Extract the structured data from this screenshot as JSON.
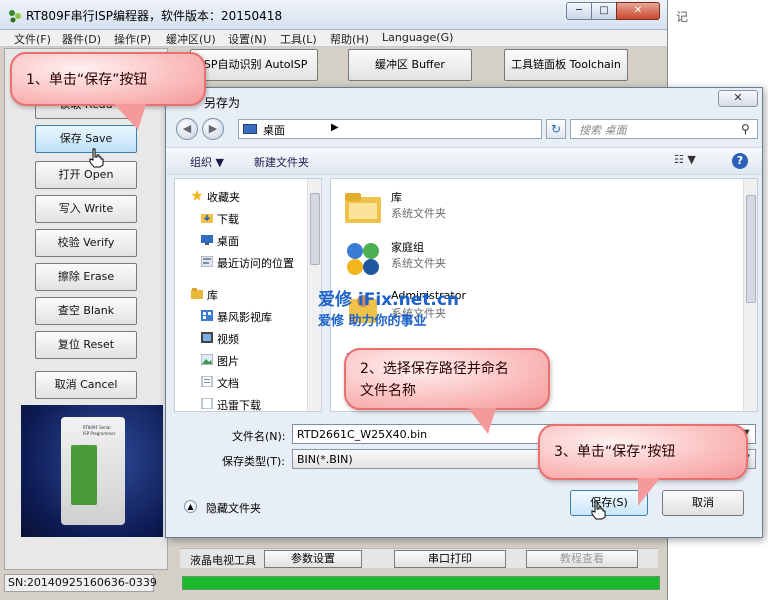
{
  "app": {
    "title": "RT809F串行ISP编程器，软件版本：20150418",
    "min_glyph": "─",
    "max_glyph": "□",
    "close_glyph": "✕"
  },
  "menu": [
    "文件(F)",
    "器件(D)",
    "操作(P)",
    "缓冲区(U)",
    "设置(N)",
    "工具(L)",
    "帮助(H)",
    "Language(G)"
  ],
  "top_buttons": {
    "autoisp": "ISP自动识别 AutoISP",
    "buffer": "缓冲区 Buffer",
    "toolchain": "工具链面板 Toolchain"
  },
  "side_buttons": [
    {
      "label": "读取 Read"
    },
    {
      "label": "保存 Save"
    },
    {
      "label": "打开 Open"
    },
    {
      "label": "写入 Write"
    },
    {
      "label": "校验 Verify"
    },
    {
      "label": "擦除 Erase"
    },
    {
      "label": "查空 Blank"
    },
    {
      "label": "复位 Reset"
    },
    {
      "label": "取消 Cancel"
    }
  ],
  "device": {
    "label1": "RT809F Serial",
    "label2": "ISP Programmer"
  },
  "status": {
    "sn": "SN:20140925160636-0339"
  },
  "bottom": {
    "lcd_label": "液晶电视工具",
    "params": "参数设置",
    "serial": "串口打印",
    "tutorial": "教程查看"
  },
  "background_right": "记",
  "dialog": {
    "title": "另存为",
    "close_glyph": "✕",
    "address": "桌面",
    "address_arrow": "▶",
    "dropdown_glyph": "▼",
    "refresh_glyph": "↻",
    "search_placeholder": "搜索 桌面",
    "search_glyph": "⚲",
    "organize": "组织 ▼",
    "new_folder": "新建文件夹",
    "view_glyph": "☷ ▼",
    "help_glyph": "?",
    "nav": {
      "favorites_header": "收藏夹",
      "favorites": [
        "下载",
        "桌面",
        "最近访问的位置"
      ],
      "libraries_header": "库",
      "libraries": [
        "暴风影视库",
        "视频",
        "图片",
        "文档",
        "迅雷下载"
      ]
    },
    "files": [
      {
        "name": "库",
        "type": "系统文件夹"
      },
      {
        "name": "家庭组",
        "type": "系统文件夹"
      },
      {
        "name": "Administrator",
        "type": "系统文件夹"
      }
    ],
    "filename_label": "文件名(N):",
    "filename_value": "RTD2661C_W25X40.bin",
    "filetype_label": "保存类型(T):",
    "filetype_value": "BIN(*.BIN)",
    "hide_folders": "隐藏文件夹",
    "hide_folders_glyph": "▲",
    "save_label": "保存(S)",
    "cancel_label": "取消"
  },
  "watermark": {
    "line1": "爱修 iFix.net.cn",
    "line2": "爱修 助力你的事业"
  },
  "callouts": {
    "step1": "1、单击“保存”按钮",
    "step2_line1": "2、选择保存路径并命名",
    "step2_line2": "文件名称",
    "step3": "3、单击“保存”按钮"
  },
  "colors": {
    "callout_fill": "#f9b3b3",
    "callout_border": "#ea6f6f",
    "progress_green": "#19b82d",
    "watermark_blue": "#1e63c8"
  }
}
